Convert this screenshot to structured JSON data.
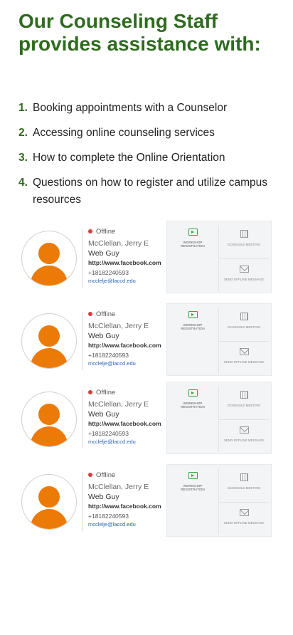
{
  "heading": "Our Counseling Staff provides assistance with:",
  "list": [
    {
      "num": "1.",
      "text": "Booking appointments with a Counselor"
    },
    {
      "num": "2.",
      "text": "Accessing online counseling services"
    },
    {
      "num": "3.",
      "text": "How to complete the Online Orientation"
    },
    {
      "num": "4.",
      "text": "Questions on how to register and utilize campus resources"
    }
  ],
  "colors": {
    "heading_green": "#2f6b1f",
    "avatar_orange": "#ec7a06",
    "offline_red": "#e03a3a"
  },
  "cards": [
    {
      "status": "Offline",
      "name": "McClellan, Jerry E",
      "role": "Web Guy",
      "url": "http://www.facebook.com",
      "phone": "+18182240593",
      "email": "mcclelje@laccd.edu",
      "tiles": {
        "workshop": "WORKSHOP REGISTRATION",
        "schedule": "SCHEDULE MEETING",
        "message": "SEND OFFLINE MESSAGE"
      }
    },
    {
      "status": "Offline",
      "name": "McClellan, Jerry E",
      "role": "Web Guy",
      "url": "http://www.facebook.com",
      "phone": "+18182240593",
      "email": "mcclelje@laccd.edu",
      "tiles": {
        "workshop": "WORKSHOP REGISTRATION",
        "schedule": "SCHEDULE MEETING",
        "message": "SEND OFFLINE MESSAGE"
      }
    },
    {
      "status": "Offline",
      "name": "McClellan, Jerry E",
      "role": "Web Guy",
      "url": "http://www.facebook.com",
      "phone": "+18182240593",
      "email": "mcclelje@laccd.edu",
      "tiles": {
        "workshop": "WORKSHOP REGISTRATION",
        "schedule": "SCHEDULE MEETING",
        "message": "SEND OFFLINE MESSAGE"
      }
    },
    {
      "status": "Offline",
      "name": "McClellan, Jerry E",
      "role": "Web Guy",
      "url": "http://www.facebook.com",
      "phone": "+18182240593",
      "email": "mcclelje@laccd.edu",
      "tiles": {
        "workshop": "WORKSHOP REGISTRATION",
        "schedule": "SCHEDULE MEETING",
        "message": "SEND OFFLINE MESSAGE"
      }
    }
  ]
}
